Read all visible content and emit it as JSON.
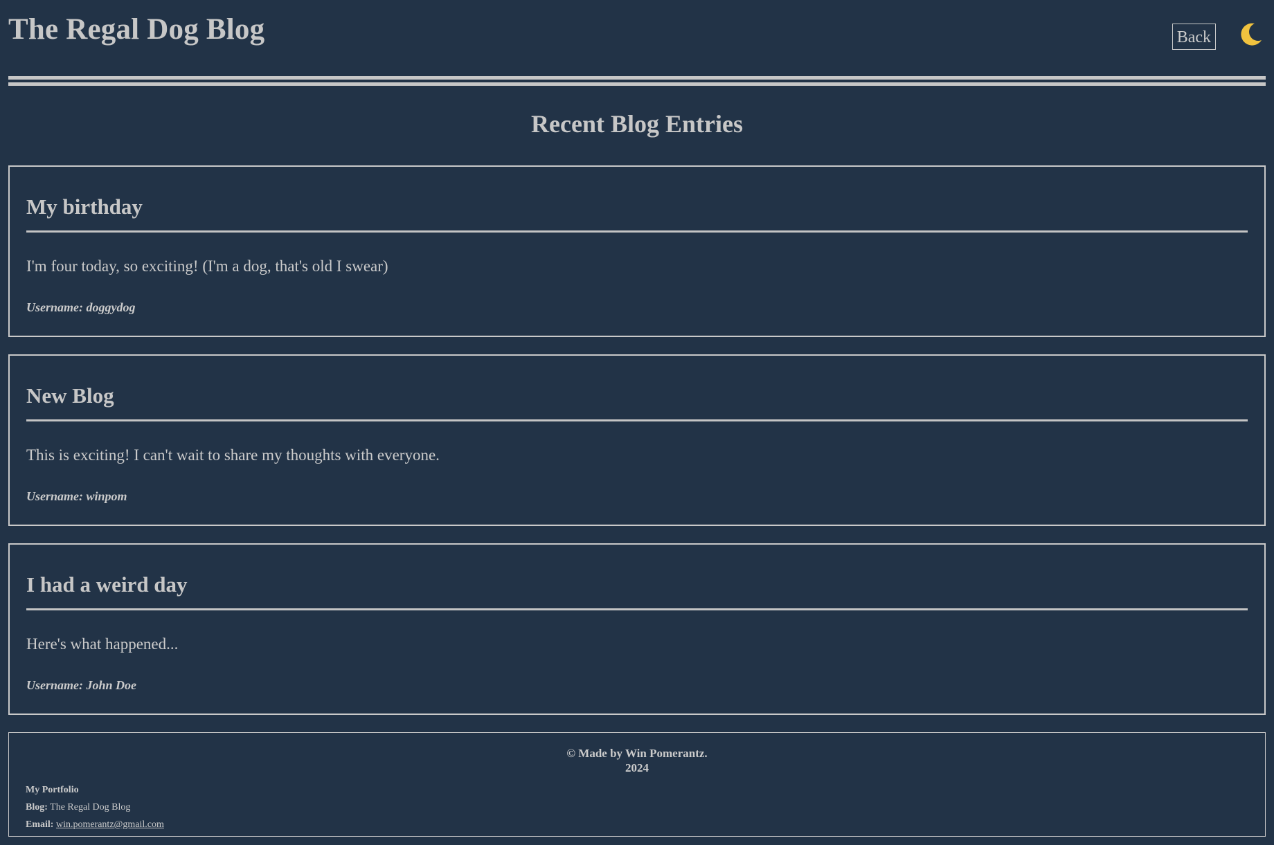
{
  "header": {
    "site_title": "The Regal Dog Blog",
    "back_label": "Back",
    "theme_toggle_icon": "crescent-moon-icon",
    "moon_color": "#f1c33f"
  },
  "main": {
    "section_title": "Recent Blog Entries",
    "posts": [
      {
        "title": "My birthday",
        "body": "I'm four today, so exciting! (I'm a dog, that's old I swear)",
        "username": "Username: doggydog"
      },
      {
        "title": "New Blog",
        "body": "This is exciting! I can't wait to share my thoughts with everyone.",
        "username": "Username: winpom"
      },
      {
        "title": "I had a weird day",
        "body": "Here's what happened...",
        "username": "Username: John Doe"
      }
    ]
  },
  "footer": {
    "copyright": "© Made by Win Pomerantz.",
    "year": "2024",
    "portfolio_label": "My Portfolio",
    "blog_label": "Blog:",
    "blog_value": "The Regal Dog Blog",
    "email_label": "Email:",
    "email_value": "win.pomerantz@gmail.com"
  },
  "colors": {
    "background": "#223347",
    "text": "#cbcbcb",
    "border": "#c9c9c9"
  }
}
